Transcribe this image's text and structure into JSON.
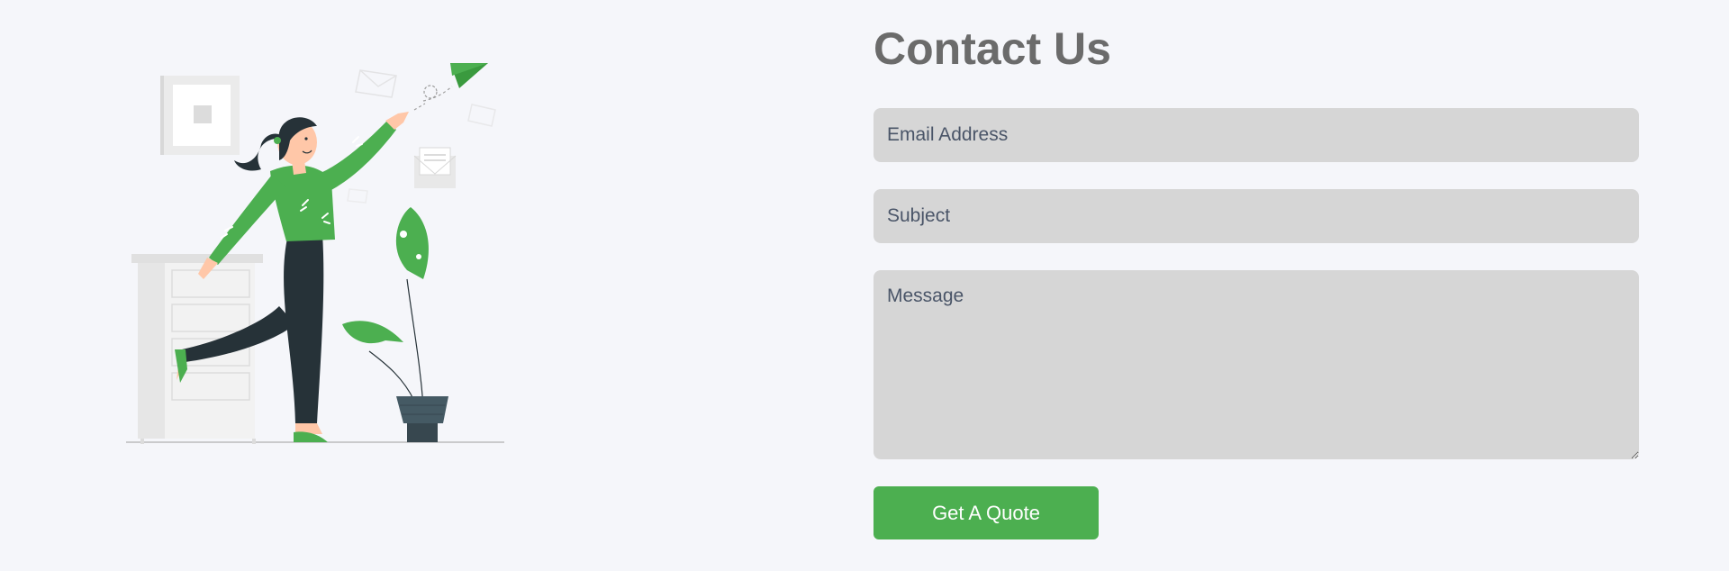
{
  "contact": {
    "title": "Contact Us",
    "email_placeholder": "Email Address",
    "subject_placeholder": "Subject",
    "message_placeholder": "Message",
    "submit_label": "Get A Quote"
  },
  "colors": {
    "background": "#f5f6fa",
    "field_background": "#d6d6d6",
    "accent": "#4caf50",
    "title": "#6b6b6b",
    "dark": "#263238"
  },
  "illustration": {
    "icon": "woman-throwing-paper-plane-illustration"
  }
}
